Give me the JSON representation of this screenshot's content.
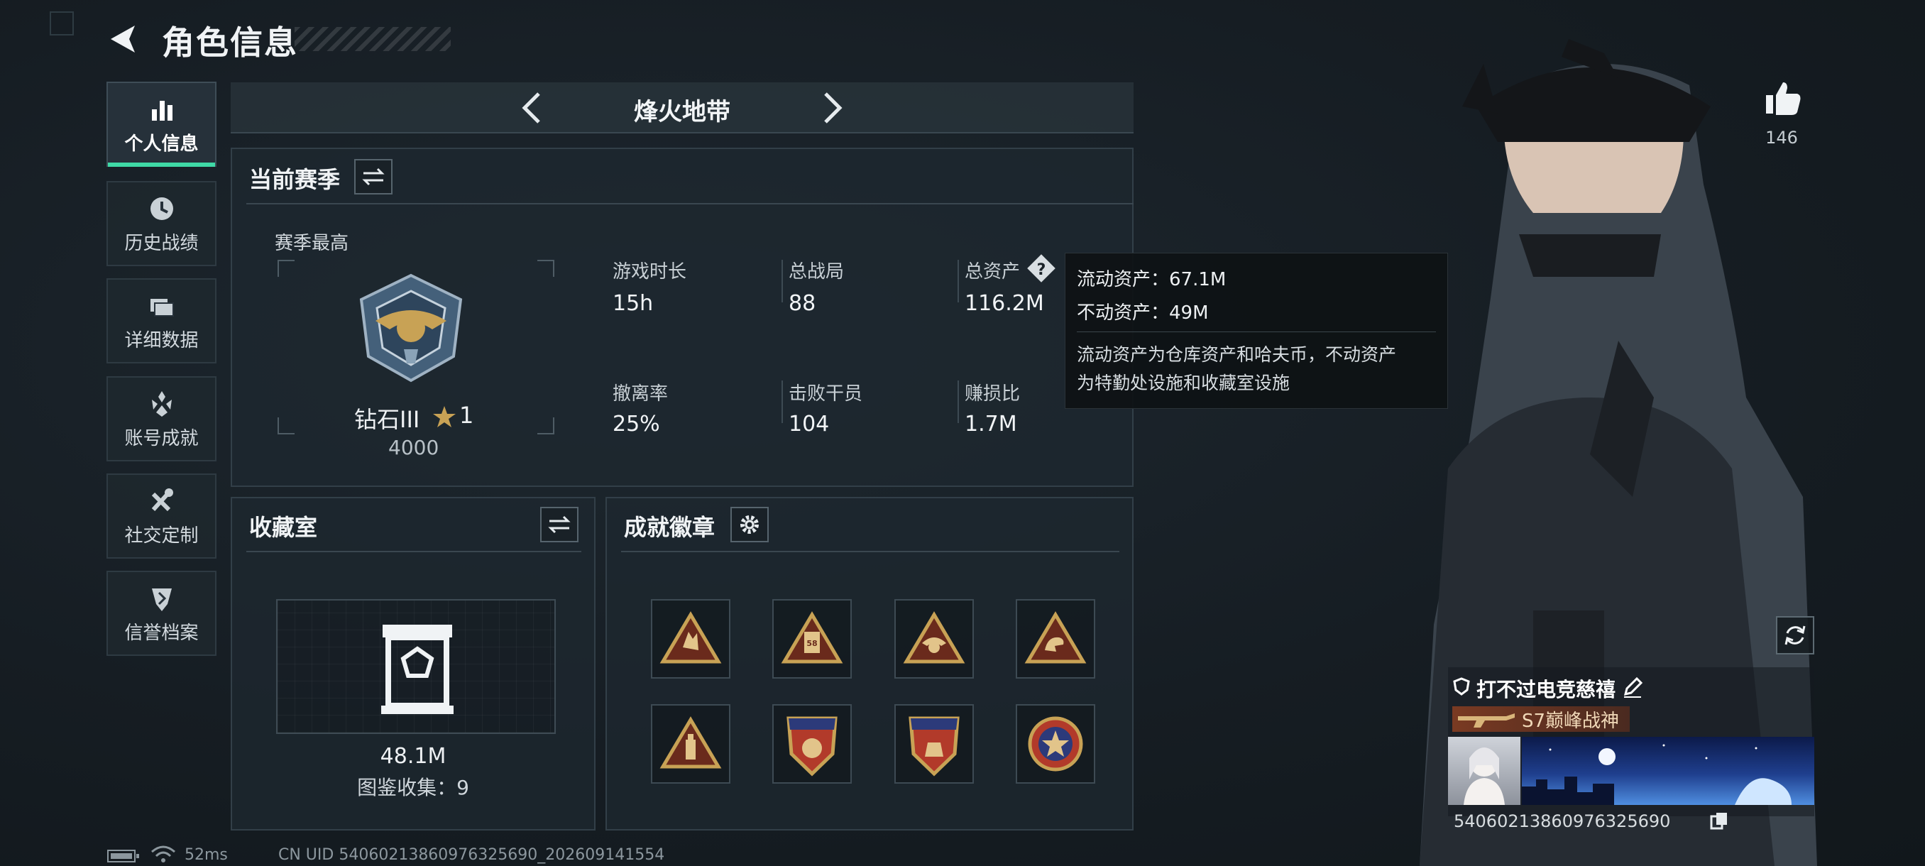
{
  "header": {
    "title": "角色信息"
  },
  "sidebar": {
    "items": [
      {
        "label": "个人信息",
        "icon": "bar-chart-icon",
        "active": true
      },
      {
        "label": "历史战绩",
        "icon": "clock-icon",
        "active": false
      },
      {
        "label": "详细数据",
        "icon": "folder-icon",
        "active": false
      },
      {
        "label": "账号成就",
        "icon": "achievement-icon",
        "active": false
      },
      {
        "label": "社交定制",
        "icon": "tools-icon",
        "active": false
      },
      {
        "label": "信誉档案",
        "icon": "shield-icon",
        "active": false
      }
    ]
  },
  "mode_bar": {
    "title": "烽火地带"
  },
  "season": {
    "title": "当前赛季",
    "peak_label": "赛季最高",
    "rank_name": "钻石III",
    "rank_stars": "1",
    "rank_points": "4000",
    "stats": [
      {
        "label": "游戏时长",
        "value": "15h"
      },
      {
        "label": "总战局",
        "value": "88"
      },
      {
        "label": "总资产",
        "value": "116.2M"
      },
      {
        "label": "撤离率",
        "value": "25%"
      },
      {
        "label": "击败干员",
        "value": "104"
      },
      {
        "label": "赚损比",
        "value": "1.7M"
      }
    ]
  },
  "tooltip": {
    "liquid": "流动资产：67.1M",
    "fixed": "不动资产：49M",
    "desc_line1": "流动资产为仓库资产和哈夫币，不动资产",
    "desc_line2": "为特勤处设施和收藏室设施"
  },
  "collection": {
    "title": "收藏室",
    "value": "48.1M",
    "catalog": "图鉴收集：9"
  },
  "achievements": {
    "title": "成就徽章",
    "badges": [
      "gesture-badge-icon",
      "card-58-badge-icon",
      "eagle-badge-icon",
      "arm-badge-icon",
      "bottle-badge-icon",
      "stars-shield-badge-icon",
      "stars-shield-badge-icon",
      "star-medal-badge-icon"
    ]
  },
  "profile": {
    "likes": "146",
    "player_name": "打不过电竞慈禧",
    "player_title": "S7巅峰战神",
    "uid_display": "5406021386097632569​0"
  },
  "footer": {
    "ping": "52ms",
    "uid": "CN UID 5406021386097632569​0_202609141554"
  },
  "colors": {
    "accent": "#3fd9a6",
    "gold": "#c8a255"
  }
}
